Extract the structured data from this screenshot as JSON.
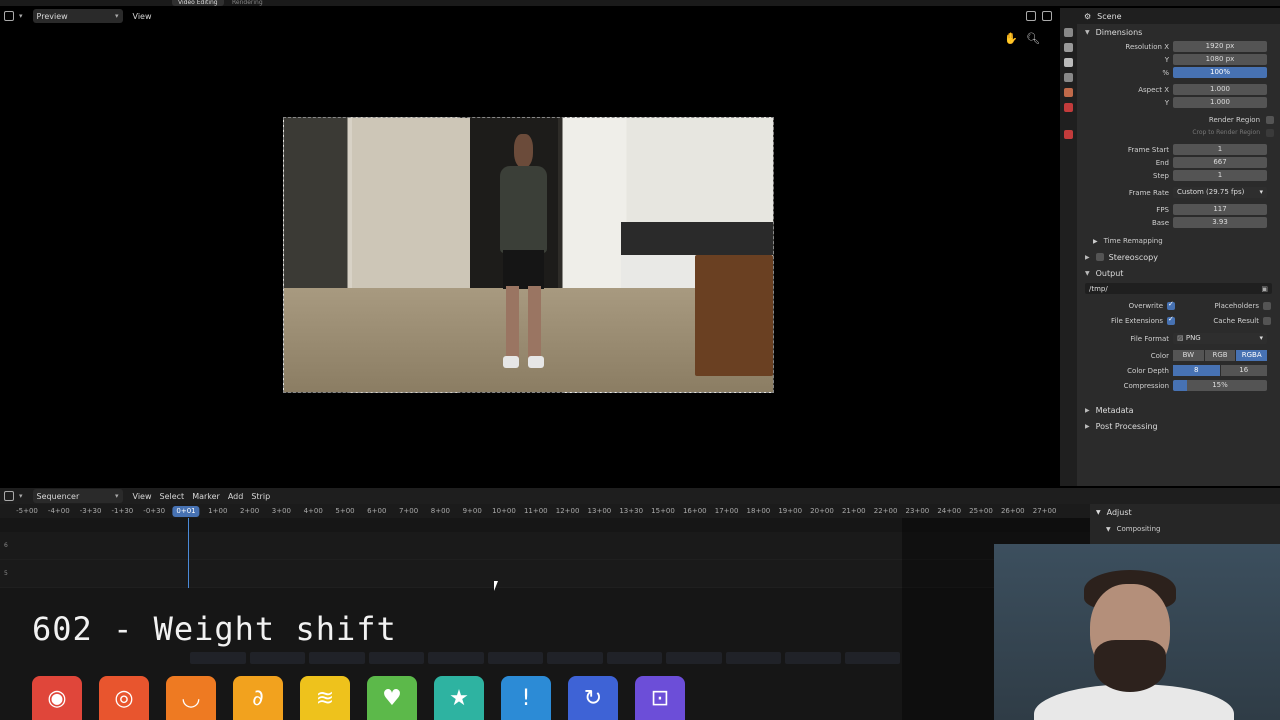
{
  "workspaces": [
    {
      "label": "Video Editing",
      "active": true
    },
    {
      "label": "Rendering",
      "active": false
    }
  ],
  "preview_header": {
    "mode_label": "Preview",
    "view_label": "View"
  },
  "properties_header": {
    "title": "Scene"
  },
  "dimensions": {
    "section_label": "Dimensions",
    "resolution_x_label": "Resolution X",
    "resolution_x": "1920 px",
    "resolution_y_label": "Y",
    "resolution_y": "1080 px",
    "percent_label": "%",
    "percent": "100%",
    "aspect_x_label": "Aspect X",
    "aspect_x": "1.000",
    "aspect_y_label": "Y",
    "aspect_y": "1.000",
    "render_region_label": "Render Region",
    "crop_label": "Crop to Render Region",
    "frame_start_label": "Frame Start",
    "frame_start": "1",
    "end_label": "End",
    "end": "667",
    "step_label": "Step",
    "step": "1",
    "frame_rate_label": "Frame Rate",
    "frame_rate": "Custom (29.75 fps)",
    "fps_label": "FPS",
    "fps": "117",
    "base_label": "Base",
    "base": "3.93",
    "time_remap_label": "Time Remapping"
  },
  "stereoscopy_label": "Stereoscopy",
  "output": {
    "section_label": "Output",
    "path": "/tmp/",
    "overwrite_label": "Overwrite",
    "placeholders_label": "Placeholders",
    "file_extensions_label": "File Extensions",
    "cache_result_label": "Cache Result",
    "file_format_label": "File Format",
    "file_format": "PNG",
    "color_label": "Color",
    "color_options": [
      "BW",
      "RGB",
      "RGBA"
    ],
    "color_depth_label": "Color Depth",
    "color_depth_options": [
      "8",
      "16"
    ],
    "compression_label": "Compression",
    "compression": "15%",
    "compression_fraction": 0.15
  },
  "metadata_label": "Metadata",
  "post_processing_label": "Post Processing",
  "sequencer_header": {
    "editor_label": "Sequencer",
    "menu": [
      "View",
      "Select",
      "Marker",
      "Add",
      "Strip"
    ]
  },
  "timeline": {
    "ticks": [
      "-5+00",
      "-4+00",
      "-3+30",
      "-1+30",
      "-0+30",
      "0+01",
      "1+00",
      "2+00",
      "3+00",
      "4+00",
      "5+00",
      "6+00",
      "7+00",
      "8+00",
      "9+00",
      "10+00",
      "11+00",
      "12+00",
      "13+00",
      "13+30",
      "15+00",
      "16+00",
      "17+00",
      "18+00",
      "19+00",
      "20+00",
      "21+00",
      "22+00",
      "23+00",
      "24+00",
      "25+00",
      "26+00",
      "27+00"
    ],
    "current": "0+01",
    "channels": [
      "6",
      "5"
    ]
  },
  "seq_side": {
    "adjust_label": "Adjust",
    "compositing_label": "Compositing"
  },
  "overlay_title": "602 - Weight shift",
  "app_icons": [
    {
      "name": "drum-icon",
      "color": "#e0463a",
      "glyph": "◉"
    },
    {
      "name": "ring-icon",
      "color": "#e8552e",
      "glyph": "◎"
    },
    {
      "name": "bowl-icon",
      "color": "#ee7a22",
      "glyph": "◡"
    },
    {
      "name": "rope-icon",
      "color": "#f2a21e",
      "glyph": "∂"
    },
    {
      "name": "lines-icon",
      "color": "#eec21c",
      "glyph": "≋"
    },
    {
      "name": "heart-icon",
      "color": "#5cb94a",
      "glyph": "♥"
    },
    {
      "name": "podium-icon",
      "color": "#2eb3a1",
      "glyph": "★"
    },
    {
      "name": "alert-icon",
      "color": "#2c8bd6",
      "glyph": "!"
    },
    {
      "name": "refresh-icon",
      "color": "#3e63d6",
      "glyph": "↻"
    },
    {
      "name": "frame-icon",
      "color": "#6c4ed8",
      "glyph": "⊡"
    }
  ]
}
